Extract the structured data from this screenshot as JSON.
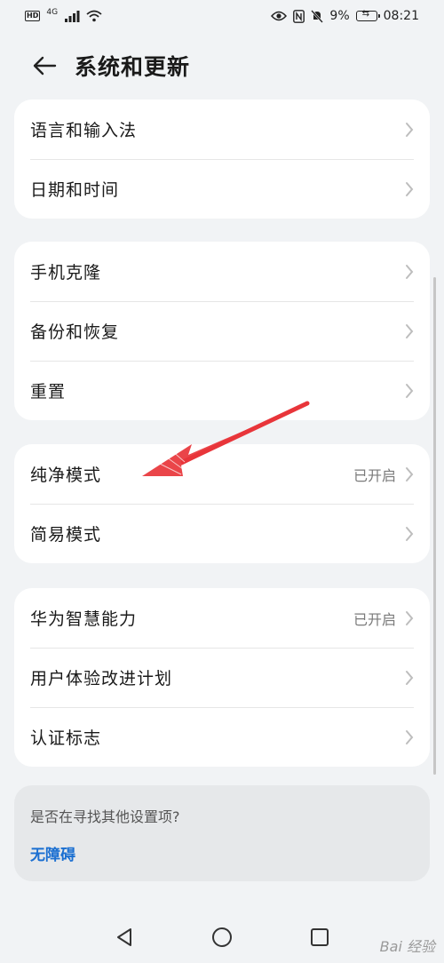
{
  "status_bar": {
    "left_badge": "HD",
    "network": "4G",
    "battery_percent": "9%",
    "time": "08:21"
  },
  "header": {
    "title": "系统和更新"
  },
  "group1": [
    {
      "label": "语言和输入法"
    },
    {
      "label": "日期和时间"
    }
  ],
  "group2": [
    {
      "label": "手机克隆"
    },
    {
      "label": "备份和恢复"
    },
    {
      "label": "重置"
    }
  ],
  "group3": [
    {
      "label": "纯净模式",
      "value": "已开启"
    },
    {
      "label": "简易模式"
    }
  ],
  "group4": [
    {
      "label": "华为智慧能力",
      "value": "已开启"
    },
    {
      "label": "用户体验改进计划"
    },
    {
      "label": "认证标志"
    }
  ],
  "suggest": {
    "question": "是否在寻找其他设置项?",
    "link": "无障碍"
  },
  "watermark": "Bai 经验",
  "icons": {
    "back": "back-arrow-icon",
    "chevron": "chevron-right-icon",
    "nav_back": "triangle-back-icon",
    "nav_home": "circle-home-icon",
    "nav_recent": "square-recent-icon"
  },
  "colors": {
    "background": "#f1f3f5",
    "card": "#ffffff",
    "link": "#1b6fd1",
    "annotation_arrow": "#e8353a"
  }
}
